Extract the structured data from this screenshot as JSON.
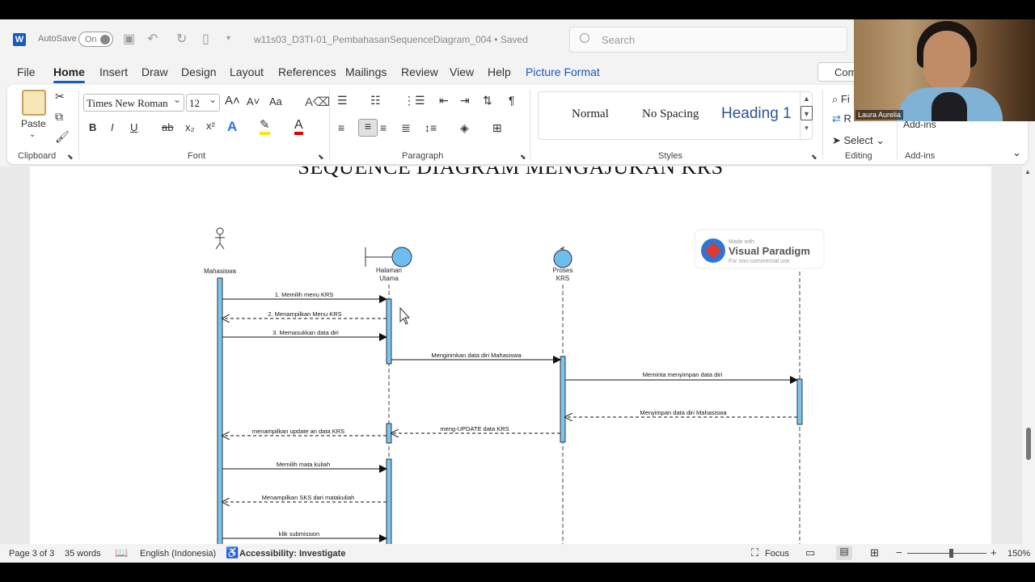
{
  "titlebar": {
    "autosave_label": "AutoSave",
    "autosave_state": "On",
    "document_title": "w11s03_D3TI-01_PembahasanSequenceDiagram_004 • Saved",
    "search_placeholder": "Search"
  },
  "menu": {
    "tabs": [
      "File",
      "Home",
      "Insert",
      "Draw",
      "Design",
      "Layout",
      "References",
      "Mailings",
      "Review",
      "View",
      "Help",
      "Picture Format"
    ],
    "active_tab": "Home",
    "comments_label": "Com"
  },
  "ribbon": {
    "clipboard": {
      "paste_label": "Paste",
      "group_label": "Clipboard"
    },
    "font": {
      "font_name": "Times New Roman",
      "font_size": "12",
      "case_label": "Aa",
      "group_label": "Font"
    },
    "paragraph": {
      "group_label": "Paragraph"
    },
    "styles": {
      "items": [
        "Normal",
        "No Spacing",
        "Heading 1"
      ],
      "group_label": "Styles"
    },
    "editing": {
      "find_label": "Fi",
      "replace_label": "R",
      "select_label": "Select",
      "group_label": "Editing"
    },
    "addins": {
      "label": "Add-ins",
      "group_label": "Add-ins"
    }
  },
  "document": {
    "heading": "SEQUENCE DIAGRAM MENGAJUKAN KRS"
  },
  "diagram": {
    "lifelines": {
      "mahasiswa": "Mahasiswa",
      "halaman_1": "Halaman",
      "halaman_2": "Utama",
      "proses_1": "Proses",
      "proses_2": "KRS"
    },
    "messages": [
      "1. Memilih menu KRS",
      "2. Menampilkan Menu KRS",
      "3. Memasukkan data diri",
      "Mengirimkan data diri Mahasiswa",
      "Meminta menyimpan data diri",
      "Menyimpan data diri Mahasiswa",
      "meng-UPDATE data KRS",
      "menampilkan update an data KRS",
      "Memilih mata kuliah",
      "Menampilkan  SKS dari matakuliah",
      "klik submission"
    ],
    "watermark": {
      "made_with": "Made with",
      "brand": "Visual Paradigm",
      "note": "For non-commercial use"
    }
  },
  "statusbar": {
    "page": "Page 3 of 3",
    "words": "35 words",
    "language": "English (Indonesia)",
    "accessibility": "Accessibility: Investigate",
    "focus": "Focus",
    "zoom": "150%"
  },
  "webcam": {
    "name": "Laura Aurelia"
  }
}
